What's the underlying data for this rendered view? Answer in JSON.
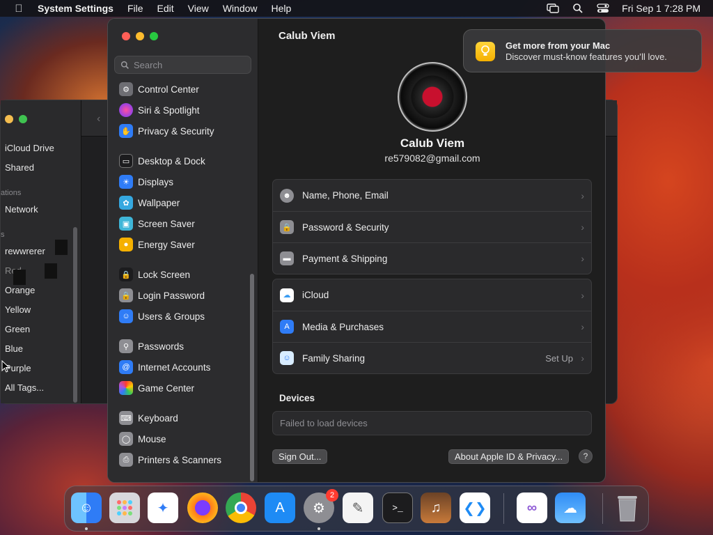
{
  "menubar": {
    "app_name": "System Settings",
    "menus": [
      "File",
      "Edit",
      "View",
      "Window",
      "Help"
    ],
    "clock": "Fri Sep 1  7:28 PM"
  },
  "finder": {
    "items": [
      "iCloud Drive",
      "Shared",
      "Network",
      "rewwrerer",
      "Red",
      "Orange",
      "Yellow",
      "Green",
      "Blue",
      "Purple",
      "All Tags..."
    ],
    "section_locations": "ations",
    "section_tags": "s"
  },
  "settings": {
    "search_placeholder": "Search",
    "sidebar": [
      {
        "label": "Control Center",
        "icon": "control-center-icon",
        "color": "#6e6e73"
      },
      {
        "label": "Siri & Spotlight",
        "icon": "siri-icon",
        "color": "#b14ce0"
      },
      {
        "label": "Privacy & Security",
        "icon": "hand-icon",
        "color": "#2f7cf6"
      },
      {
        "label": "Desktop & Dock",
        "icon": "desktop-icon",
        "color": "#1c1c1e"
      },
      {
        "label": "Displays",
        "icon": "sun-icon",
        "color": "#2f7cf6"
      },
      {
        "label": "Wallpaper",
        "icon": "wallpaper-icon",
        "color": "#35a8e0"
      },
      {
        "label": "Screen Saver",
        "icon": "screen-saver-icon",
        "color": "#3fb6d8"
      },
      {
        "label": "Energy Saver",
        "icon": "bulb-icon",
        "color": "#f5b000"
      },
      {
        "label": "Lock Screen",
        "icon": "lock-icon",
        "color": "#1c1c1e"
      },
      {
        "label": "Login Password",
        "icon": "lock-icon",
        "color": "#8e8e93"
      },
      {
        "label": "Users & Groups",
        "icon": "users-icon",
        "color": "#2f7cf6"
      },
      {
        "label": "Passwords",
        "icon": "key-icon",
        "color": "#8e8e93"
      },
      {
        "label": "Internet Accounts",
        "icon": "at-icon",
        "color": "#2f7cf6"
      },
      {
        "label": "Game Center",
        "icon": "game-center-icon",
        "color": "#ffffff"
      },
      {
        "label": "Keyboard",
        "icon": "keyboard-icon",
        "color": "#8e8e93"
      },
      {
        "label": "Mouse",
        "icon": "mouse-icon",
        "color": "#8e8e93"
      },
      {
        "label": "Printers & Scanners",
        "icon": "printer-icon",
        "color": "#8e8e93"
      }
    ],
    "main": {
      "title": "Calub Viem",
      "user_name": "Calub Viem",
      "email": "re579082@gmail.com",
      "group1": [
        {
          "label": "Name, Phone, Email",
          "icon": "person-icon",
          "color": "#8e8e93"
        },
        {
          "label": "Password & Security",
          "icon": "lock-icon",
          "color": "#8e8e93"
        },
        {
          "label": "Payment & Shipping",
          "icon": "card-icon",
          "color": "#8e8e93"
        }
      ],
      "group2": [
        {
          "label": "iCloud",
          "icon": "cloud-icon",
          "color": "#ffffff",
          "extra": ""
        },
        {
          "label": "Media & Purchases",
          "icon": "app-store-icon",
          "color": "#2f7cf6",
          "extra": ""
        },
        {
          "label": "Family Sharing",
          "icon": "family-icon",
          "color": "#d8ecff",
          "extra": "Set Up"
        }
      ],
      "devices_title": "Devices",
      "devices_status": "Failed to load devices",
      "sign_out": "Sign Out...",
      "about": "About Apple ID & Privacy...",
      "help": "?"
    }
  },
  "notification": {
    "title": "Get more from your Mac",
    "body": "Discover must-know features you’ll love."
  },
  "dock": {
    "settings_badge": "2"
  }
}
